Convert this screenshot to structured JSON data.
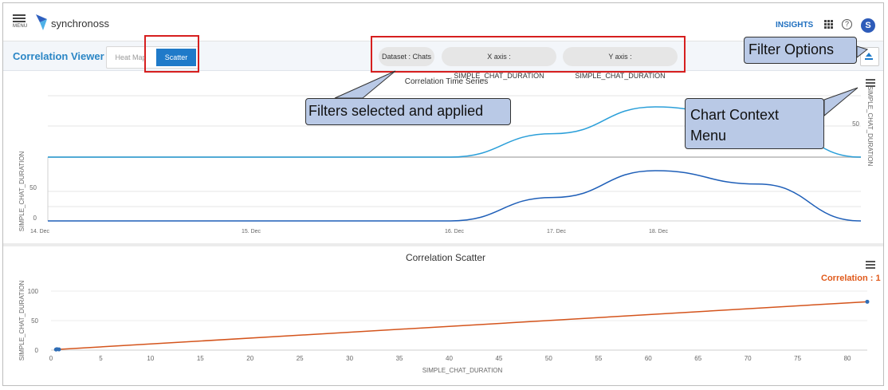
{
  "header": {
    "menu_label": "MENU",
    "brand": "synchronoss",
    "insights": "INSIGHTS",
    "help_glyph": "?",
    "avatar_initial": "S",
    "brand_color": "#2d5bb9"
  },
  "toolbar": {
    "page_title": "Correlation Viewer",
    "heatmap_label": "Heat Map",
    "scatter_label": "Scatter",
    "filters": [
      "Dataset : Chats",
      "X axis : SIMPLE_CHAT_DURATION",
      "Y axis : SIMPLE_CHAT_DURATION"
    ],
    "accent_color": "#1f7ac9"
  },
  "annotations": {
    "filter_options": "Filter Options",
    "filters_applied": "Filters selected and applied",
    "context_menu": "Chart Context Menu"
  },
  "chart_data": [
    {
      "type": "line",
      "title": "Correlation Time Series",
      "xlabel": "",
      "ylabel": "SIMPLE_CHAT_DURATION",
      "y2label": "SIMPLE_CHAT_DURATION",
      "x_ticks": [
        "14. Dec",
        "15. Dec",
        "16. Dec",
        "17. Dec",
        "18. Dec"
      ],
      "x": [
        0,
        1,
        2,
        2.5,
        3,
        3.5,
        4
      ],
      "y_ticks": [
        0,
        50
      ],
      "y2_ticks": [
        50
      ],
      "series": [
        {
          "color": "#2b9fd9",
          "values": [
            0,
            0,
            0,
            35,
            75,
            55,
            0
          ]
        },
        {
          "color": "#1f5fb8",
          "values": [
            0,
            0,
            0,
            35,
            75,
            55,
            0
          ]
        }
      ],
      "grid": true
    },
    {
      "type": "scatter",
      "title": "Correlation Scatter",
      "xlabel": "SIMPLE_CHAT_DURATION",
      "ylabel": "SIMPLE_CHAT_DURATION",
      "xlim": [
        0,
        82
      ],
      "ylim": [
        0,
        100
      ],
      "x_ticks": [
        0,
        5,
        10,
        15,
        20,
        25,
        30,
        35,
        40,
        45,
        50,
        55,
        60,
        65,
        70,
        75,
        80
      ],
      "y_ticks": [
        0,
        50,
        100
      ],
      "points": [
        {
          "x": 0.5,
          "y": 1
        },
        {
          "x": 0.6,
          "y": 1.5
        },
        {
          "x": 0.8,
          "y": 1.2
        },
        {
          "x": 82,
          "y": 82
        }
      ],
      "trendline": {
        "from": [
          0.5,
          1
        ],
        "to": [
          82,
          82
        ],
        "color": "#d4541c"
      },
      "point_color": "#2f6db5",
      "correlation": "Correlation : 1",
      "grid": true
    }
  ]
}
